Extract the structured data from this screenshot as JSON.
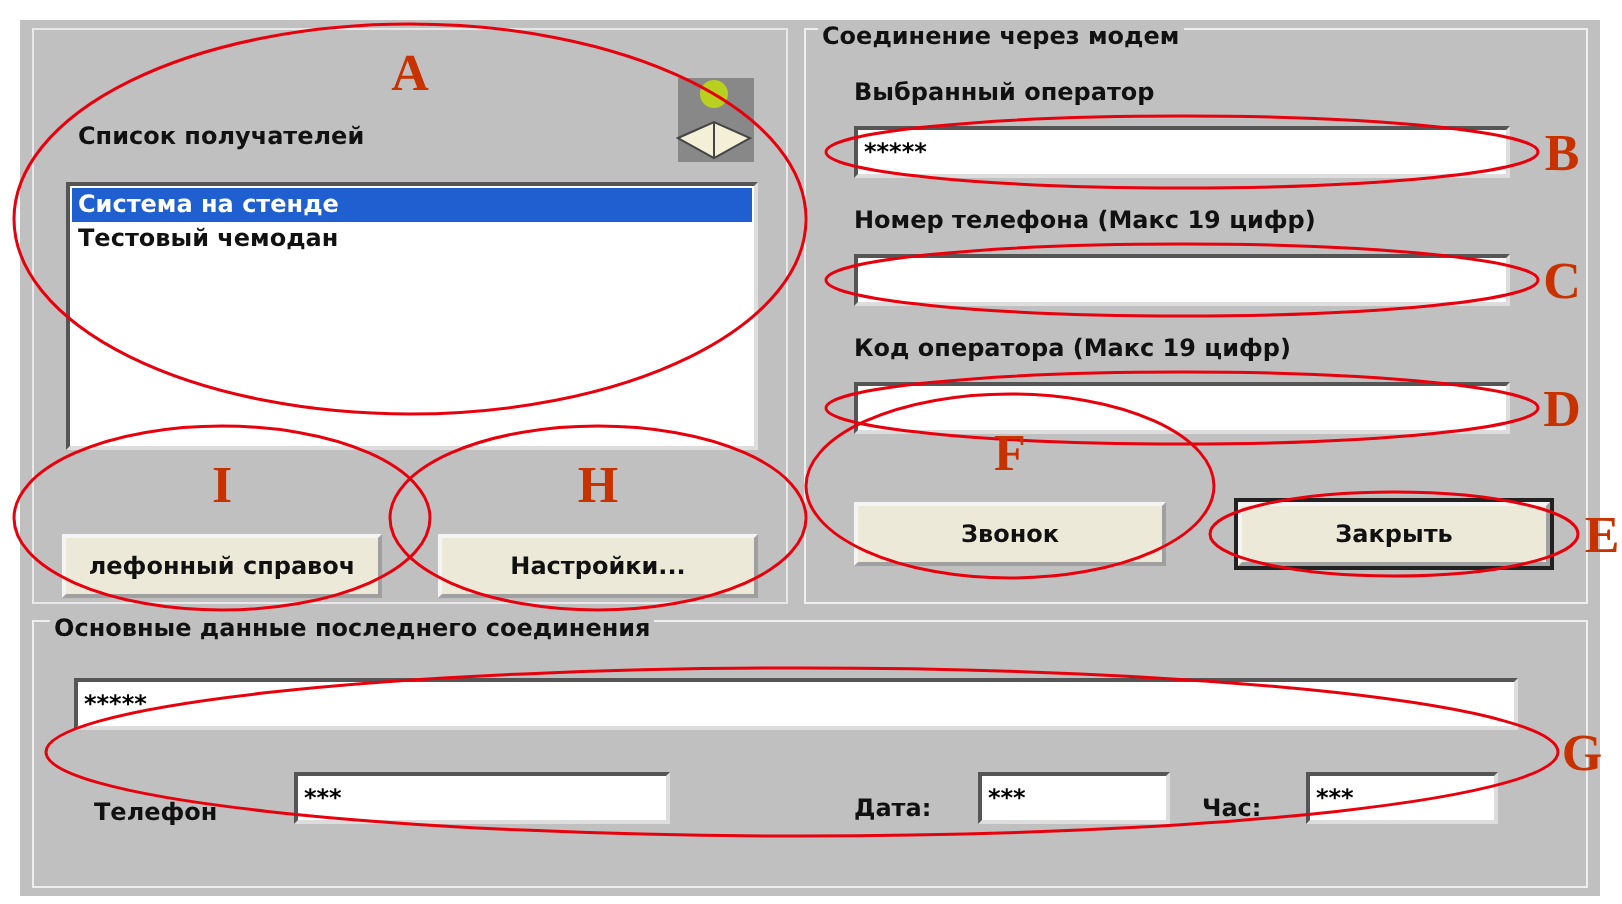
{
  "recipients": {
    "label": "Список получателей",
    "annotation": {
      "letter": "A"
    },
    "items": [
      {
        "text": "Система на стенде",
        "selected": true
      },
      {
        "text": "Тестовый чемодан",
        "selected": false
      }
    ]
  },
  "left_buttons": [
    {
      "label": "лефонный справоч",
      "annotation": {
        "letter": "I"
      }
    },
    {
      "label": "Настройки...",
      "annotation": {
        "letter": "H"
      }
    }
  ],
  "modem": {
    "title": "Соединение через модем",
    "fields": [
      {
        "label": "Выбранный оператор",
        "value": "*****",
        "annotation": {
          "letter": "B"
        }
      },
      {
        "label": "Номер телефона (Макс 19 цифр)",
        "annotation": {
          "letter": "C"
        }
      },
      {
        "label": "Код оператора (Макс 19 цифр)",
        "annotation": {
          "letter": "D"
        }
      }
    ],
    "buttons": [
      {
        "label": "Звонок",
        "default": false,
        "annotation": {
          "letter": "F"
        }
      },
      {
        "label": "Закрыть",
        "default": true,
        "annotation": {
          "letter": "E"
        }
      }
    ]
  },
  "last_connection": {
    "title": "Основные данные последнего соединения",
    "annotation": {
      "letter": "G"
    },
    "operator_value": "*****",
    "fields": [
      {
        "label": "Телефон",
        "value": "***"
      },
      {
        "label": "Дата:",
        "value": "***"
      },
      {
        "label": "Час:",
        "value": "***"
      }
    ]
  }
}
